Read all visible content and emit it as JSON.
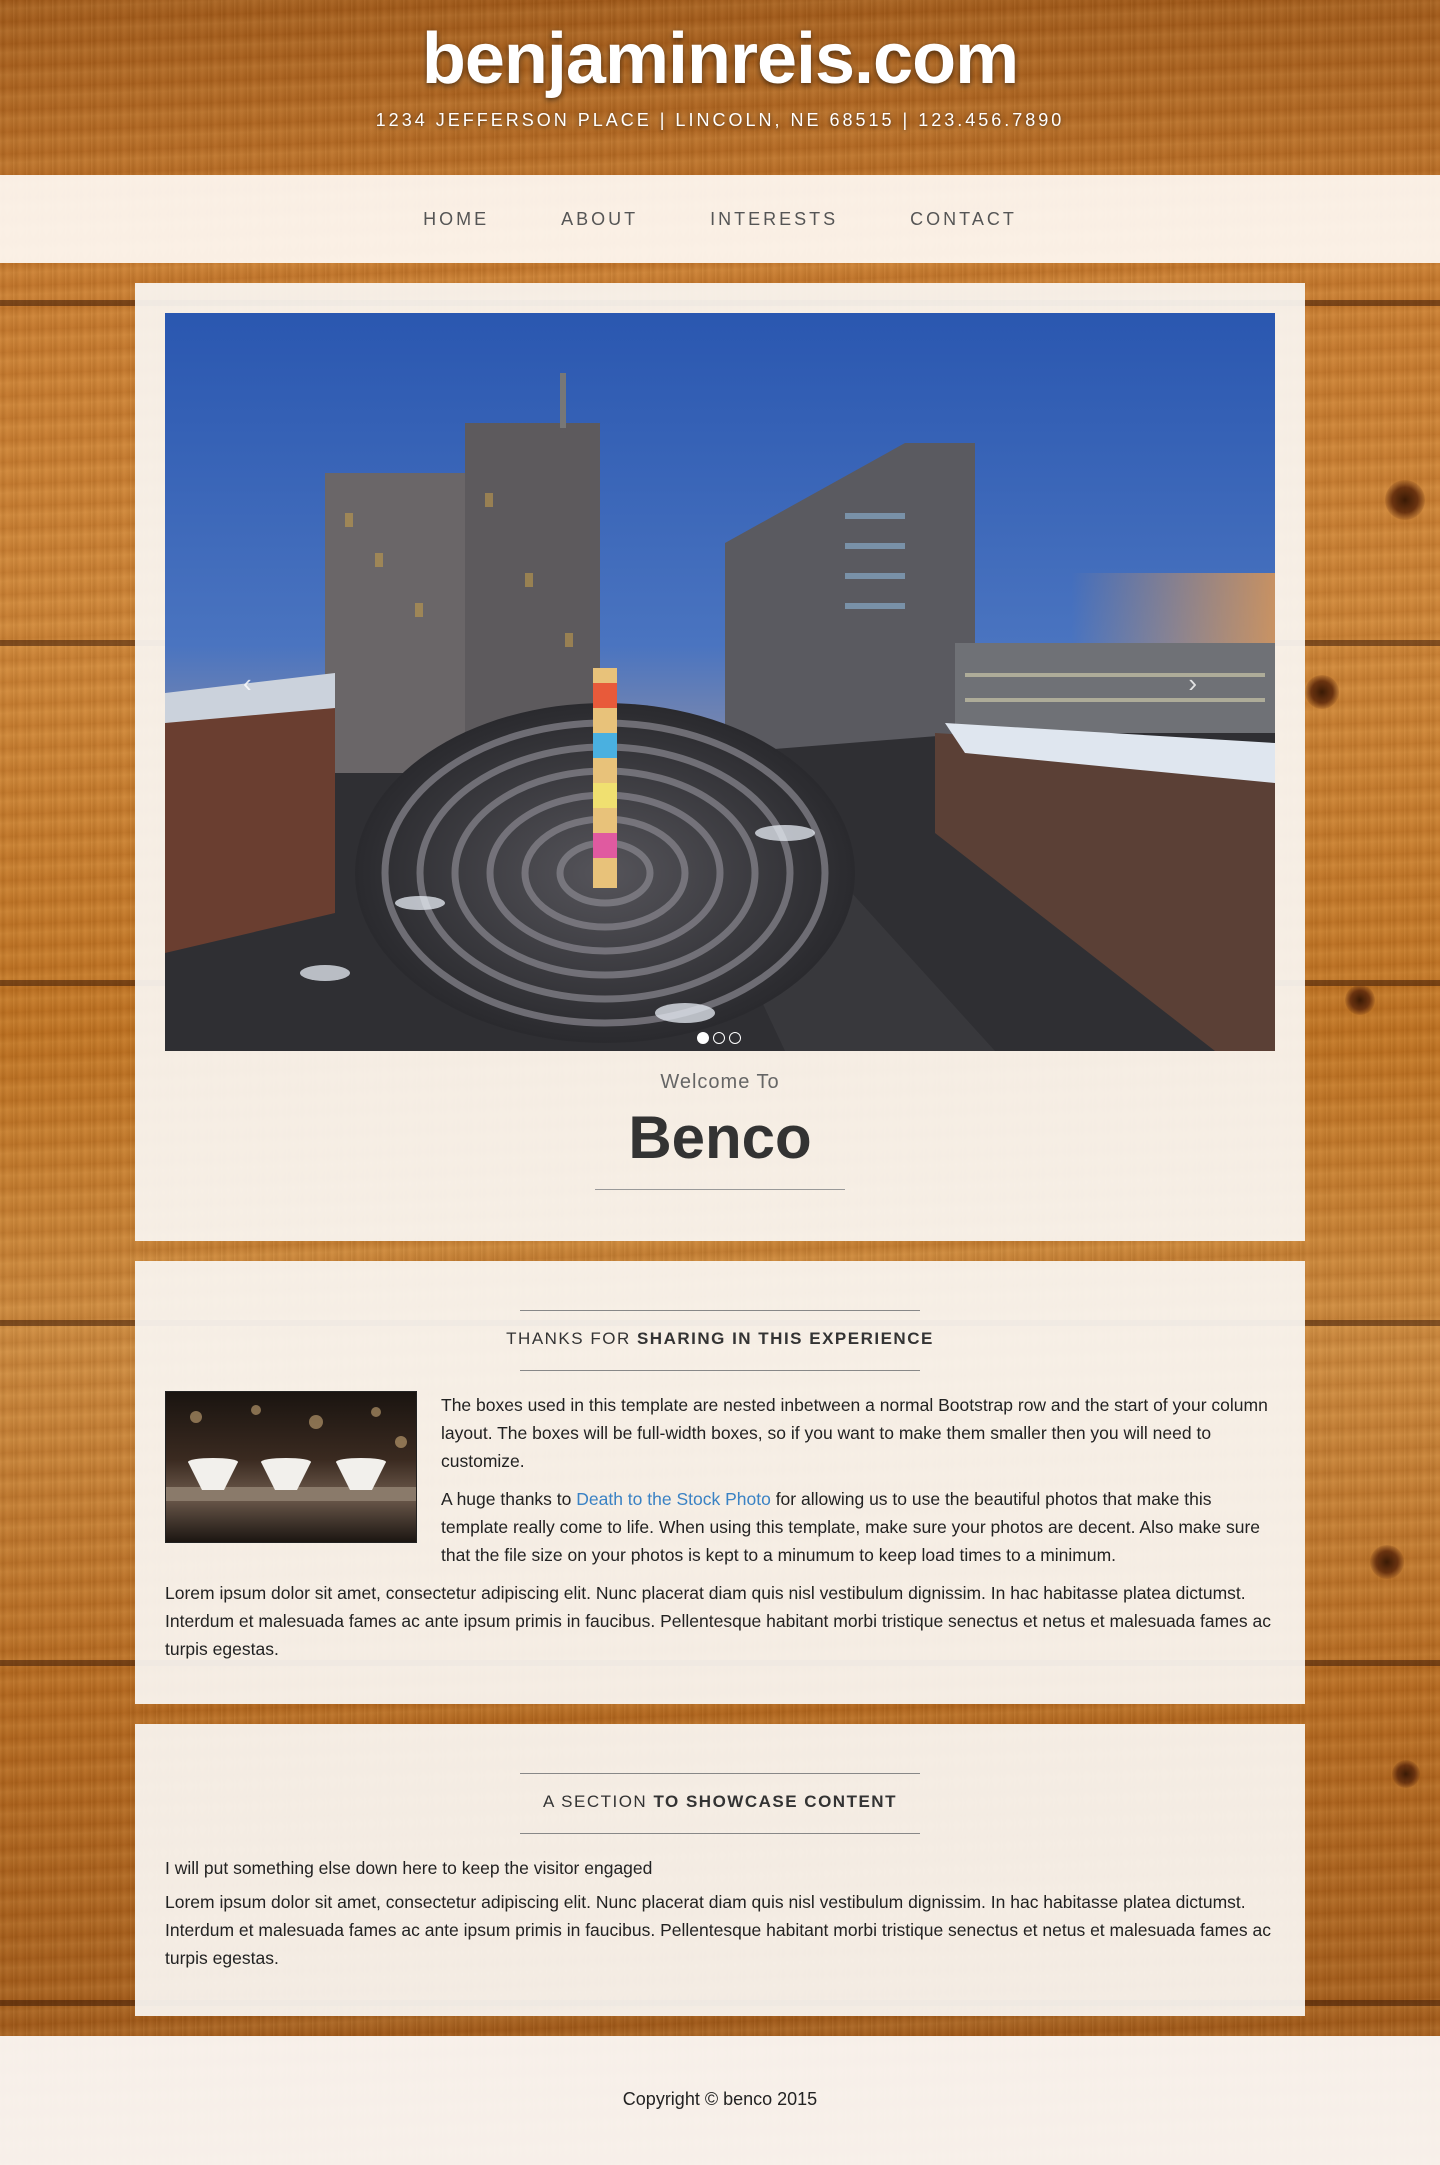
{
  "header": {
    "title": "benjaminreis.com",
    "address": "1234 JEFFERSON PLACE | LINCOLN, NE 68515 | 123.456.7890"
  },
  "nav": {
    "items": [
      {
        "label": "HOME"
      },
      {
        "label": "ABOUT"
      },
      {
        "label": "INTERESTS"
      },
      {
        "label": "CONTACT"
      }
    ]
  },
  "carousel": {
    "prev_icon": "chevron-left-icon",
    "next_icon": "chevron-right-icon",
    "prev_glyph": "‹",
    "next_glyph": "›",
    "slide_count": 3,
    "active_slide": 1
  },
  "welcome": {
    "subtitle": "Welcome To",
    "title": "Benco"
  },
  "section1": {
    "heading_light": "THANKS FOR ",
    "heading_bold": "SHARING IN THIS EXPERIENCE",
    "para1": "The boxes used in this template are nested inbetween a normal Bootstrap row and the start of your column layout. The boxes will be full-width boxes, so if you want to make them smaller then you will need to customize.",
    "para2_before": "A huge thanks to ",
    "para2_link": "Death to the Stock Photo",
    "para2_after": " for allowing us to use the beautiful photos that make this template really come to life. When using this template, make sure your photos are decent. Also make sure that the file size on your photos is kept to a minumum to keep load times to a minimum.",
    "para3": "Lorem ipsum dolor sit amet, consectetur adipiscing elit. Nunc placerat diam quis nisl vestibulum dignissim. In hac habitasse platea dictumst. Interdum et malesuada fames ac ante ipsum primis in faucibus. Pellentesque habitant morbi tristique senectus et netus et malesuada fames ac turpis egestas."
  },
  "section2": {
    "heading_light": "A SECTION ",
    "heading_bold": "TO SHOWCASE CONTENT",
    "para1": "I will put something else down here to keep the visitor engaged",
    "para2": "Lorem ipsum dolor sit amet, consectetur adipiscing elit. Nunc placerat diam quis nisl vestibulum dignissim. In hac habitasse platea dictumst. Interdum et malesuada fames ac ante ipsum primis in faucibus. Pellentesque habitant morbi tristique senectus et netus et malesuada fames ac turpis egestas."
  },
  "footer": {
    "copyright": "Copyright © benco 2015"
  },
  "colors": {
    "link": "#3a82c4",
    "box_bg": "#faf6f2",
    "wood": "#c97a2c"
  }
}
